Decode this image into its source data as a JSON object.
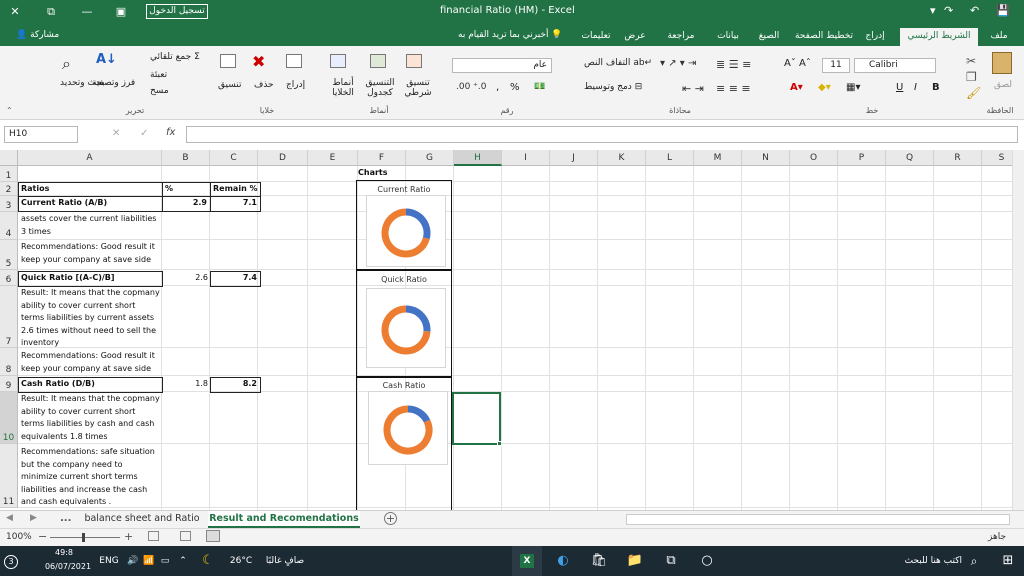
{
  "window": {
    "title": "financial Ratio (HM)  -  Excel",
    "login_label": "تسجيل الدخول",
    "controls": {
      "restore": "▣",
      "minimize": "—",
      "maximize": "⧉",
      "close": "✕"
    },
    "qat": {
      "save": "💾",
      "undo": "↶",
      "redo": "↷",
      "customize": "▾"
    }
  },
  "ribbon_tabs": [
    {
      "label": "ملف"
    },
    {
      "label": "الشريط الرئيسي",
      "active": true
    },
    {
      "label": "إدراج"
    },
    {
      "label": "تخطيط الصفحة"
    },
    {
      "label": "الصيغ"
    },
    {
      "label": "بيانات"
    },
    {
      "label": "مراجعة"
    },
    {
      "label": "عرض"
    },
    {
      "label": "تعليمات"
    }
  ],
  "tell_me": "أخبرني بما تريد القيام به",
  "share_label": "مشاركة",
  "ribbon": {
    "clipboard": {
      "label": "الحافظة",
      "paste": "لصق"
    },
    "font": {
      "label": "خط",
      "name": "Calibri",
      "size": "11",
      "bold": "B",
      "italic": "I",
      "underline": "U"
    },
    "alignment": {
      "label": "محاذاة",
      "wrap": "التفاف النص",
      "merge": "دمج وتوسيط"
    },
    "number": {
      "label": "رقم",
      "format": "عام",
      "percent": "%",
      "comma": ","
    },
    "styles": {
      "label": "أنماط",
      "conditional": "تنسيق شرطي",
      "as_table": "التنسيق كجدول",
      "cell_styles": "أنماط الخلايا"
    },
    "cells": {
      "label": "خلايا",
      "insert": "إدراج",
      "delete": "حذف",
      "format": "تنسيق"
    },
    "editing": {
      "label": "تحرير",
      "autosum": "جمع تلقائي",
      "fill": "تعبئة",
      "clear": "مسح",
      "sort": "فرز وتصفية",
      "find": "بحث وتحديد"
    }
  },
  "formula_bar": {
    "name_box": "H10",
    "fx": "fx",
    "cancel": "✕",
    "enter": "✓",
    "formula": ""
  },
  "columns": [
    "A",
    "B",
    "C",
    "D",
    "E",
    "F",
    "G",
    "H",
    "I",
    "J",
    "K",
    "L",
    "M",
    "N",
    "O",
    "P",
    "Q",
    "R",
    "S"
  ],
  "rows": [
    "1",
    "2",
    "3",
    "4",
    "5",
    "6",
    "7",
    "8",
    "9",
    "10",
    "11"
  ],
  "cells": {
    "F1": "Charts",
    "A2": "Ratios",
    "B2": "%",
    "C2": "Remain %",
    "A3": "Current Ratio (A/B)",
    "B3": "2.9",
    "C3": "7.1",
    "A4": "assets cover the current liabilities 3 times",
    "A5": "Recommendations: Good result it keep your company at save side",
    "A6": "Quick Ratio    [(A-C)/B]",
    "B6": "2.6",
    "C6": "7.4",
    "A7": "Result: It means that the copmany ability to cover current short terms liabilities by current assets 2.6 times without need to sell the inventory",
    "A8": "Recommendations: Good result it keep your company at save side",
    "A9": "Cash Ratio        (D/B)",
    "B9": "1.8",
    "C9": "8.2",
    "A10": "Result: It means that the copmany ability to cover current short terms liabilities by cash and cash equivalents  1.8 times",
    "A11": "Recommendations: safe situation but the company need to minimize current short terms liabilities and increase the cash and cash equivalents ."
  },
  "charts": [
    {
      "title": "Current Ratio",
      "ratio": 2.9,
      "remain": 7.1
    },
    {
      "title": "Quick Ratio",
      "ratio": 2.6,
      "remain": 7.4
    },
    {
      "title": "Cash Ratio",
      "ratio": 1.8,
      "remain": 8.2
    }
  ],
  "colors": {
    "excel_green": "#217346",
    "series_blue": "#4472c4",
    "series_orange": "#ed7d31"
  },
  "sheet_tabs": {
    "more": "...",
    "tabs": [
      "balance sheet and Ratio",
      "Result and Recomendations"
    ],
    "active": 1,
    "add": "+"
  },
  "status": {
    "ready": "جاهز",
    "zoom": "100%"
  },
  "taskbar": {
    "search_placeholder": "اكتب هنا للبحث",
    "weather_text": "صافٍ غالبًا",
    "temp": "26°C",
    "lang": "ENG",
    "time": "49:8",
    "date": "06/07/2021",
    "notifications": "3"
  }
}
